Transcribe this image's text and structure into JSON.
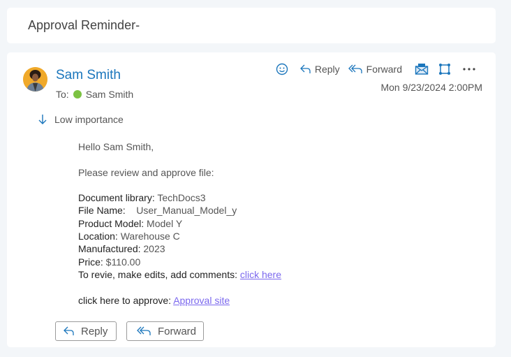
{
  "subject": "Approval Reminder-",
  "sender": {
    "name": "Sam Smith"
  },
  "recipients": {
    "label": "To:",
    "name": "Sam Smith",
    "status_color": "#7cc242"
  },
  "importance": "Low importance",
  "toolbar": {
    "reply": "Reply",
    "forward": "Forward"
  },
  "date": "Mon 9/23/2024 2:00PM",
  "body": {
    "greeting": "Hello Sam Smith,",
    "intro": "Please review and approve file:",
    "fields": [
      {
        "label": "Document library:",
        "value": " TechDocs3"
      },
      {
        "label": "File Name:",
        "value": "    User_Manual_Model_y"
      },
      {
        "label": "Product Model:",
        "value": " Model Y"
      },
      {
        "label": "Location:",
        "value": " Warehouse C"
      },
      {
        "label": "Manufactured:",
        "value": " 2023"
      },
      {
        "label": "Price:",
        "value": " $110.00"
      }
    ],
    "review_text": "To revie, make edits, add comments: ",
    "review_link": "click here",
    "approve_text": "click here to approve: ",
    "approve_link": "Approval site"
  },
  "footer": {
    "reply": "Reply",
    "forward": "Forward"
  }
}
